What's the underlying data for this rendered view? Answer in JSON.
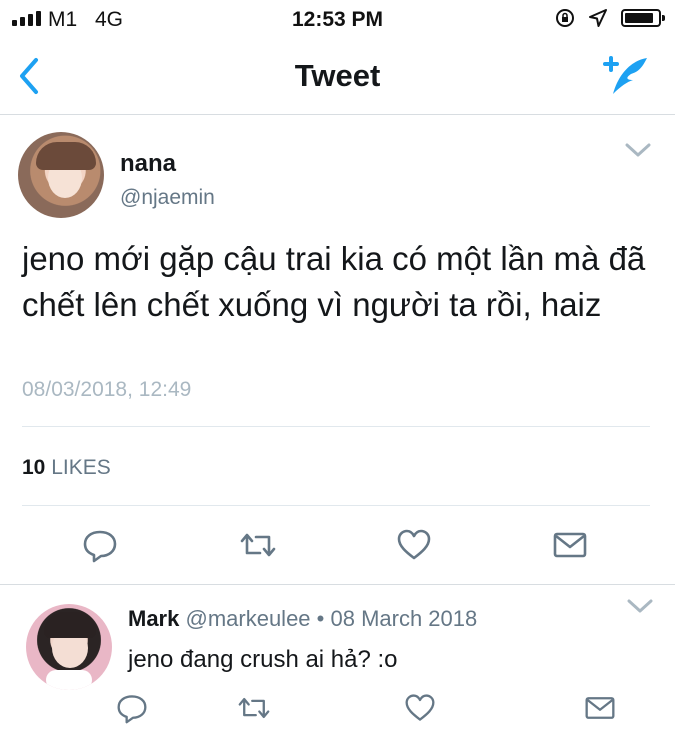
{
  "status_bar": {
    "carrier": "M1",
    "network": "4G",
    "time": "12:53 PM"
  },
  "nav": {
    "title": "Tweet",
    "back_icon": "chevron-left-icon",
    "compose_icon": "compose-tweet-icon"
  },
  "tweet": {
    "display_name": "nana",
    "handle": "@njaemin",
    "text": "jeno mới gặp cậu trai kia có một lần mà đã chết lên chết xuống vì người ta rồi, haiz",
    "timestamp": "08/03/2018, 12:49",
    "likes_count": "10",
    "likes_label": "LIKES"
  },
  "reply": {
    "display_name": "Mark",
    "handle": "@markeulee",
    "separator": " • ",
    "date": "08 March 2018",
    "text": "jeno đang crush ai hả? :o"
  },
  "colors": {
    "accent": "#1da1f2",
    "secondary_text": "#657786",
    "timestamp": "#aab8c2",
    "icon": "#657786"
  }
}
